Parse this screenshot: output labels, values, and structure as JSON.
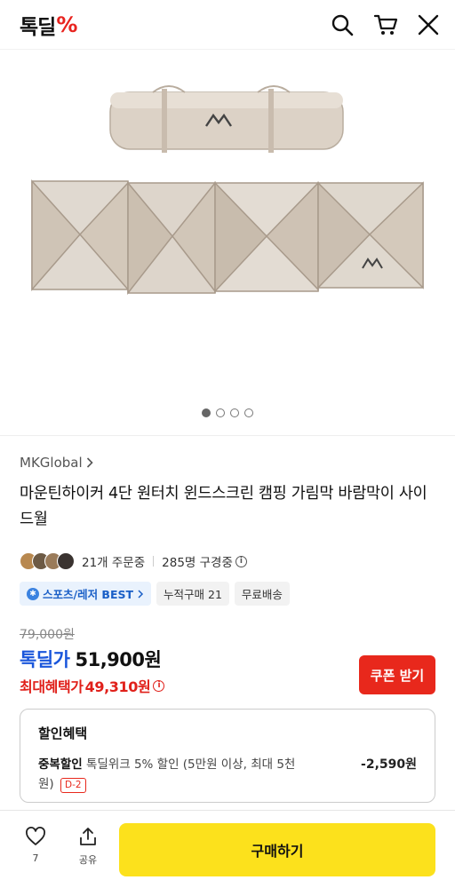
{
  "header": {
    "logo_main": "톡딜",
    "logo_mark": "%",
    "icons": [
      "search-icon",
      "cart-icon",
      "close-icon"
    ]
  },
  "gallery": {
    "image": "product-photo",
    "image_count": 4,
    "active_index": 1
  },
  "product": {
    "seller": "MKGlobal",
    "title": "마운틴하이커 4단 원터치 윈드스크린 캠핑 가림막 바람막이 사이드월",
    "order_count": "21개 주문중",
    "viewer_count": "285명 구경중",
    "chips": [
      {
        "label": "스포츠/레저 BEST",
        "icon": "gear-icon"
      },
      {
        "label": "누적구매 21"
      },
      {
        "label": "무료배송"
      }
    ]
  },
  "price": {
    "original": "79,000원",
    "label": "톡딜가",
    "deal": "51,900원",
    "max_benefit_label": "최대혜택가",
    "max_benefit": "49,310원",
    "coupon_button": "쿠폰 받기"
  },
  "benefit": {
    "title": "할인혜택",
    "name": "중복할인",
    "desc": "톡딜위크 5% 할인 (5만원 이상, 최대 5천원)",
    "dday": "D-2",
    "amount": "-2,590원"
  },
  "bottom": {
    "like_count": "7",
    "share_label": "공유",
    "buy_button": "구매하기"
  },
  "colors": {
    "brand_red": "#e8231e",
    "accent_blue": "#1a56db",
    "buy_yellow": "#fce11c"
  }
}
